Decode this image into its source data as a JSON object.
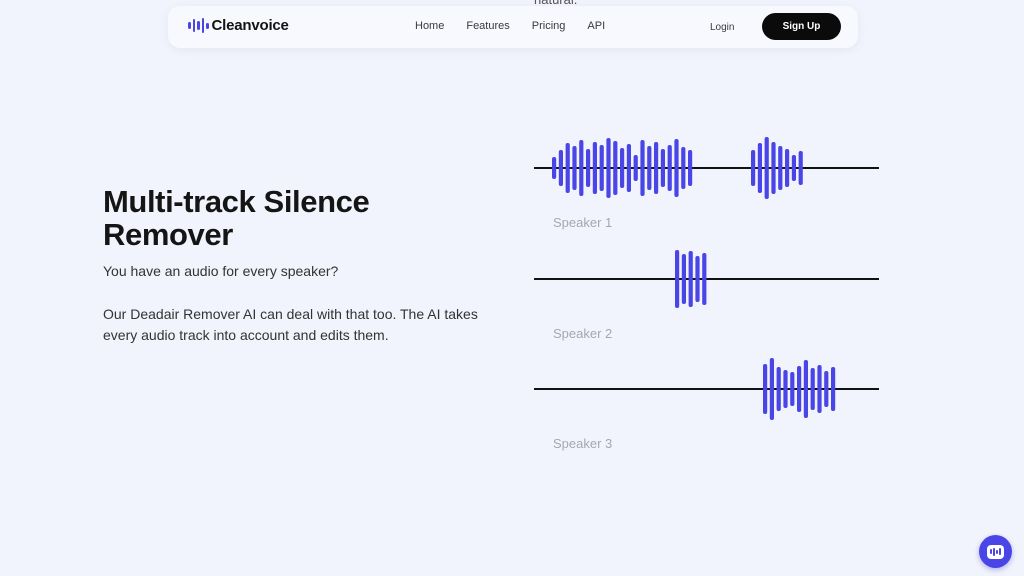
{
  "clipped_text": "natural.",
  "navbar": {
    "brand": "Cleanvoice",
    "links": [
      "Home",
      "Features",
      "Pricing",
      "API"
    ],
    "login": "Login",
    "signup": "Sign Up"
  },
  "hero": {
    "title": "Multi-track Silence Remover",
    "question": "You have an audio for every speaker?",
    "description": "Our Deadair Remover AI can deal with that too. The AI takes every audio track into account and edits them."
  },
  "tracks": [
    {
      "label": "Speaker 1"
    },
    {
      "label": "Speaker 2"
    },
    {
      "label": "Speaker 3"
    }
  ],
  "colors": {
    "accent": "#4a45e6",
    "background": "#f2f4fd",
    "waveform_line": "#111111",
    "label_gray": "#a4a7b2"
  },
  "icons": {
    "logo": "waveform-bars-icon",
    "chat": "chat-bubble-icon"
  }
}
